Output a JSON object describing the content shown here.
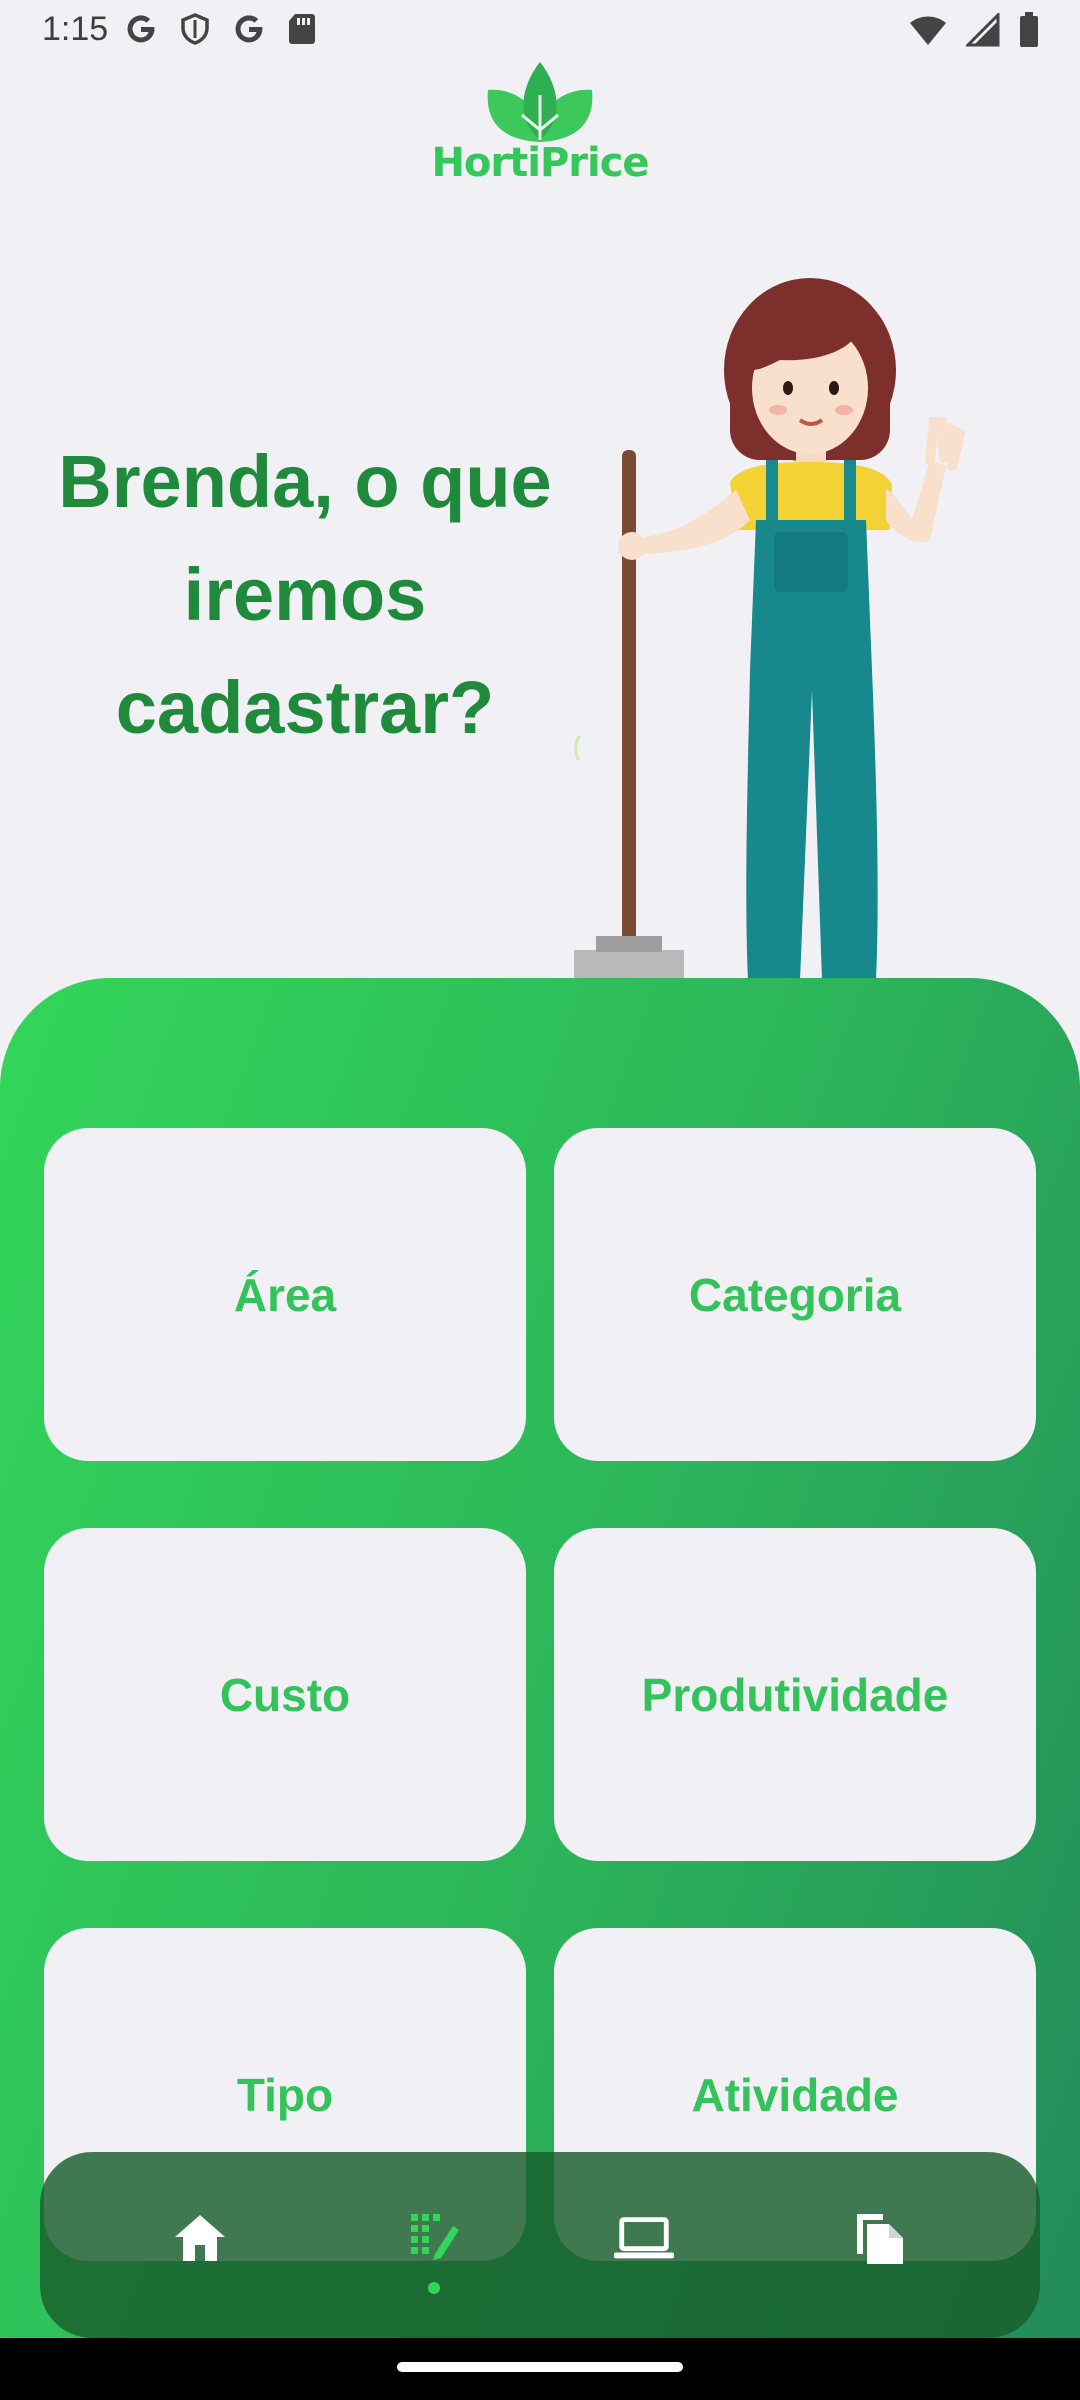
{
  "status_bar": {
    "time": "1:15",
    "left_icons": [
      "google-icon",
      "shield-icon",
      "google-icon",
      "sd-card-icon"
    ],
    "right_icons": [
      "wifi-icon",
      "signal-icon",
      "battery-icon"
    ]
  },
  "app": {
    "logo_text": "HortiPrice",
    "brand_color": "#34c759"
  },
  "heading": {
    "line1": "Brenda,  o que",
    "line2": "iremos",
    "line3": "cadastrar?"
  },
  "cards": [
    {
      "label": "Área"
    },
    {
      "label": "Categoria"
    },
    {
      "label": "Custo"
    },
    {
      "label": "Produtividade"
    },
    {
      "label": "Tipo"
    },
    {
      "label": "Atividade"
    }
  ],
  "bottom_nav": {
    "items": [
      {
        "icon": "home-icon",
        "active": false
      },
      {
        "icon": "register-icon",
        "active": true
      },
      {
        "icon": "laptop-icon",
        "active": false
      },
      {
        "icon": "documents-icon",
        "active": false
      }
    ]
  },
  "colors": {
    "panel_start": "#33d65a",
    "panel_end": "#228a5a",
    "heading": "#1f8a3c",
    "card_text": "#34c35a"
  }
}
